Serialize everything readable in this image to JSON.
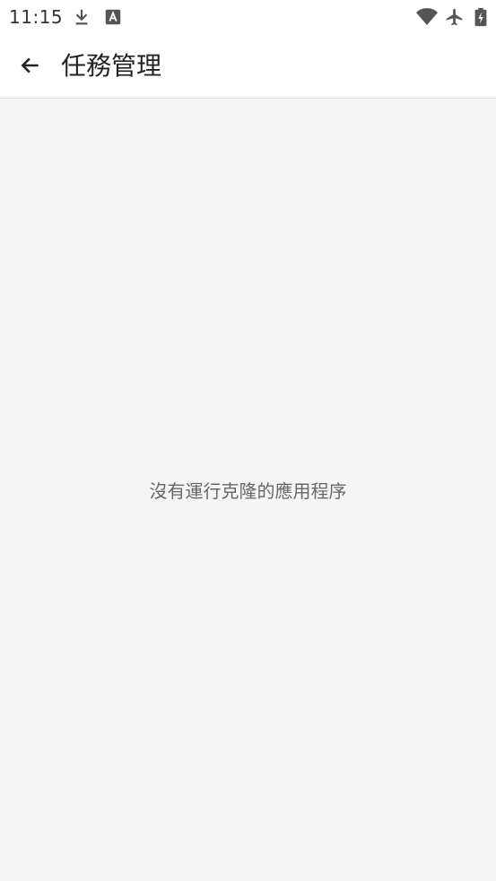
{
  "status_bar": {
    "time": "11:15",
    "left_icons": [
      "download-icon",
      "text-a-icon"
    ],
    "right_icons": [
      "wifi-icon",
      "airplane-mode-icon",
      "battery-charging-icon"
    ]
  },
  "app_bar": {
    "back_icon": "arrow-left-icon",
    "title": "任務管理"
  },
  "content": {
    "empty_message": "沒有運行克隆的應用程序"
  },
  "colors": {
    "background": "#f5f5f5",
    "surface": "#ffffff",
    "text_primary": "#222222",
    "text_secondary": "#666666",
    "icon": "#555555"
  }
}
